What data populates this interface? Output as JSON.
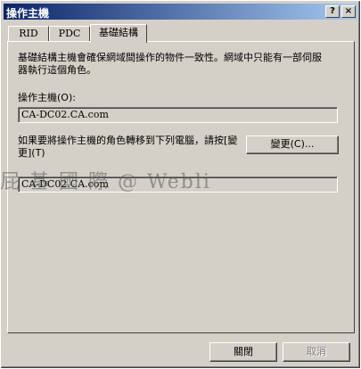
{
  "window": {
    "title": "操作主機"
  },
  "titlebar": {
    "help_glyph": "?",
    "close_glyph": "×"
  },
  "tabs": [
    {
      "label": "RID"
    },
    {
      "label": "PDC"
    },
    {
      "label": "基礎結構"
    }
  ],
  "infrastructure": {
    "description": "基礎結構主機會確保網域間操作的物件一致性。網域中只能有一部伺服器執行這個角色。",
    "operations_master_label": "操作主機(O):",
    "operations_master_value": "CA-DC02.CA.com",
    "transfer_text": "如果要將操作主機的角色轉移到下列電腦，請按[變更](T)",
    "change_button": "變更(C)...",
    "target_computer_value": "CA-DC02.CA.com"
  },
  "footer": {
    "close_button": "關閉",
    "cancel_button": "取消"
  },
  "watermark": {
    "text": "屁 基 國 際 @ Webli"
  },
  "colors": {
    "face": "#d4d0c8",
    "title_start": "#0a246a",
    "title_end": "#a6caf0"
  }
}
